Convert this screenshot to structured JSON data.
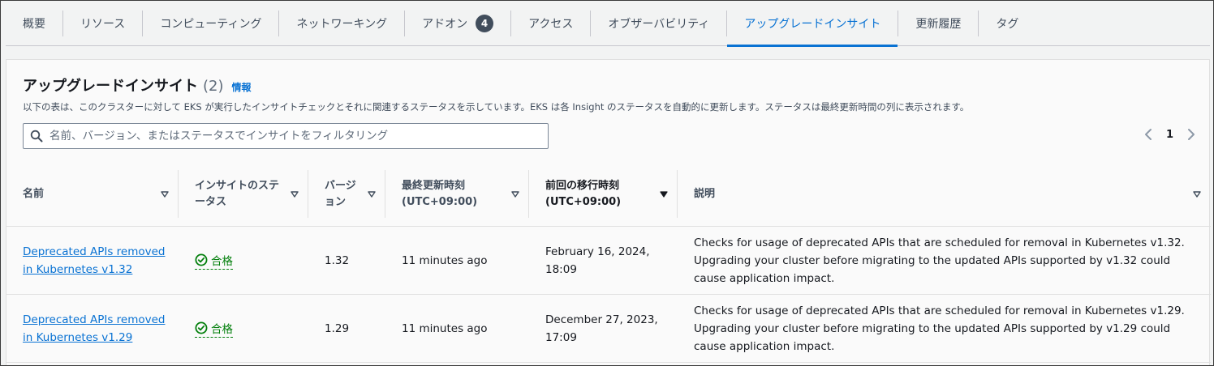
{
  "tabs": [
    {
      "label": "概要",
      "active": false
    },
    {
      "label": "リソース",
      "active": false
    },
    {
      "label": "コンピューティング",
      "active": false
    },
    {
      "label": "ネットワーキング",
      "active": false
    },
    {
      "label": "アドオン",
      "active": false,
      "badge": "4"
    },
    {
      "label": "アクセス",
      "active": false
    },
    {
      "label": "オブザーバビリティ",
      "active": false
    },
    {
      "label": "アップグレードインサイト",
      "active": true
    },
    {
      "label": "更新履歴",
      "active": false
    },
    {
      "label": "タグ",
      "active": false
    }
  ],
  "panel": {
    "title": "アップグレードインサイト",
    "count": "(2)",
    "info_link": "情報",
    "description": "以下の表は、このクラスターに対して EKS が実行したインサイトチェックとそれに関連するステータスを示しています。EKS は各 Insight のステータスを自動的に更新します。ステータスは最終更新時間の列に表示されます。"
  },
  "filter": {
    "placeholder": "名前、バージョン、またはステータスでインサイトをフィルタリング",
    "value": ""
  },
  "pagination": {
    "current_page": "1"
  },
  "table": {
    "columns": [
      {
        "label": "名前",
        "sort": "none"
      },
      {
        "label": "インサイトのステータス",
        "sort": "none"
      },
      {
        "label": "バージョン",
        "sort": "none"
      },
      {
        "label": "最終更新時刻 (UTC+09:00)",
        "sort": "none"
      },
      {
        "label": "前回の移行時刻 (UTC+09:00)",
        "sort": "descending"
      },
      {
        "label": "説明",
        "sort": "none"
      }
    ],
    "rows": [
      {
        "name": "Deprecated APIs removed in Kubernetes v1.32",
        "status": "合格",
        "version": "1.32",
        "last_updated": "11 minutes ago",
        "last_transition": "February 16, 2024, 18:09",
        "description": "Checks for usage of deprecated APIs that are scheduled for removal in Kubernetes v1.32. Upgrading your cluster before migrating to the updated APIs supported by v1.32 could cause application impact."
      },
      {
        "name": "Deprecated APIs removed in Kubernetes v1.29",
        "status": "合格",
        "version": "1.29",
        "last_updated": "11 minutes ago",
        "last_transition": "December 27, 2023, 17:09",
        "description": "Checks for usage of deprecated APIs that are scheduled for removal in Kubernetes v1.29. Upgrading your cluster before migrating to the updated APIs supported by v1.29 could cause application impact."
      }
    ]
  },
  "colors": {
    "link": "#0972d3",
    "success": "#037f0c",
    "text": "#16191f",
    "muted": "#414d5c",
    "border": "#e0e0e0"
  },
  "icons": {
    "search": "search-icon",
    "status_success": "check-circle-icon",
    "sort_none": "caret-down-outline-icon",
    "sort_desc": "caret-down-filled-icon",
    "pager_prev": "chevron-left-icon",
    "pager_next": "chevron-right-icon"
  }
}
